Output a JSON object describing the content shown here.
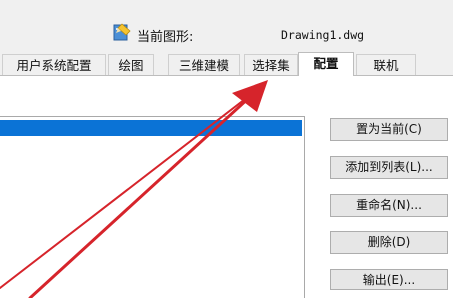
{
  "header": {
    "current_drawing_label": "当前图形:",
    "current_drawing_file": "Drawing1.dwg"
  },
  "tabs": [
    {
      "label": "用户系统配置",
      "active": false
    },
    {
      "label": "绘图",
      "active": false
    },
    {
      "label": "三维建模",
      "active": false
    },
    {
      "label": "选择集",
      "active": false
    },
    {
      "label": "配置",
      "active": true
    },
    {
      "label": "联机",
      "active": false
    }
  ],
  "buttons": {
    "set_current": "置为当前(C)",
    "add_to_list": "添加到列表(L)...",
    "rename": "重命名(N)...",
    "delete": "删除(D)",
    "export": "输出(E)..."
  },
  "colors": {
    "selection": "#0b73d6",
    "arrow": "#d6242b",
    "background": "#f0f0f0"
  },
  "icons": [
    "drawing-file-icon"
  ]
}
